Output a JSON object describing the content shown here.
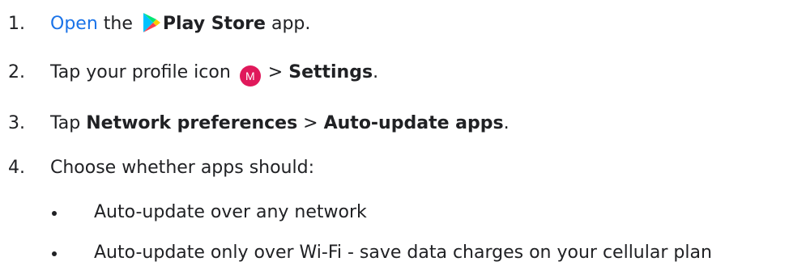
{
  "steps": [
    {
      "number": "1.",
      "link": "Open",
      "pre": " the",
      "icon": "play-store-icon",
      "bold": "Play Store",
      "post": " app."
    },
    {
      "number": "2.",
      "pre": "Tap your profile icon",
      "avatar_letter": "M",
      "mid": " > ",
      "bold": "Settings",
      "post": "."
    },
    {
      "number": "3.",
      "pre": "Tap ",
      "bold1": "Network preferences",
      "mid": " > ",
      "bold2": "Auto-update apps",
      "post": "."
    },
    {
      "number": "4.",
      "text": "Choose whether apps should:"
    }
  ],
  "bullets": [
    "Auto-update over any network",
    "Auto-update only over Wi-Fi - save data charges on your cellular plan"
  ],
  "colors": {
    "link": "#1a73e8",
    "text": "#202124",
    "avatar": "#e0195b"
  }
}
